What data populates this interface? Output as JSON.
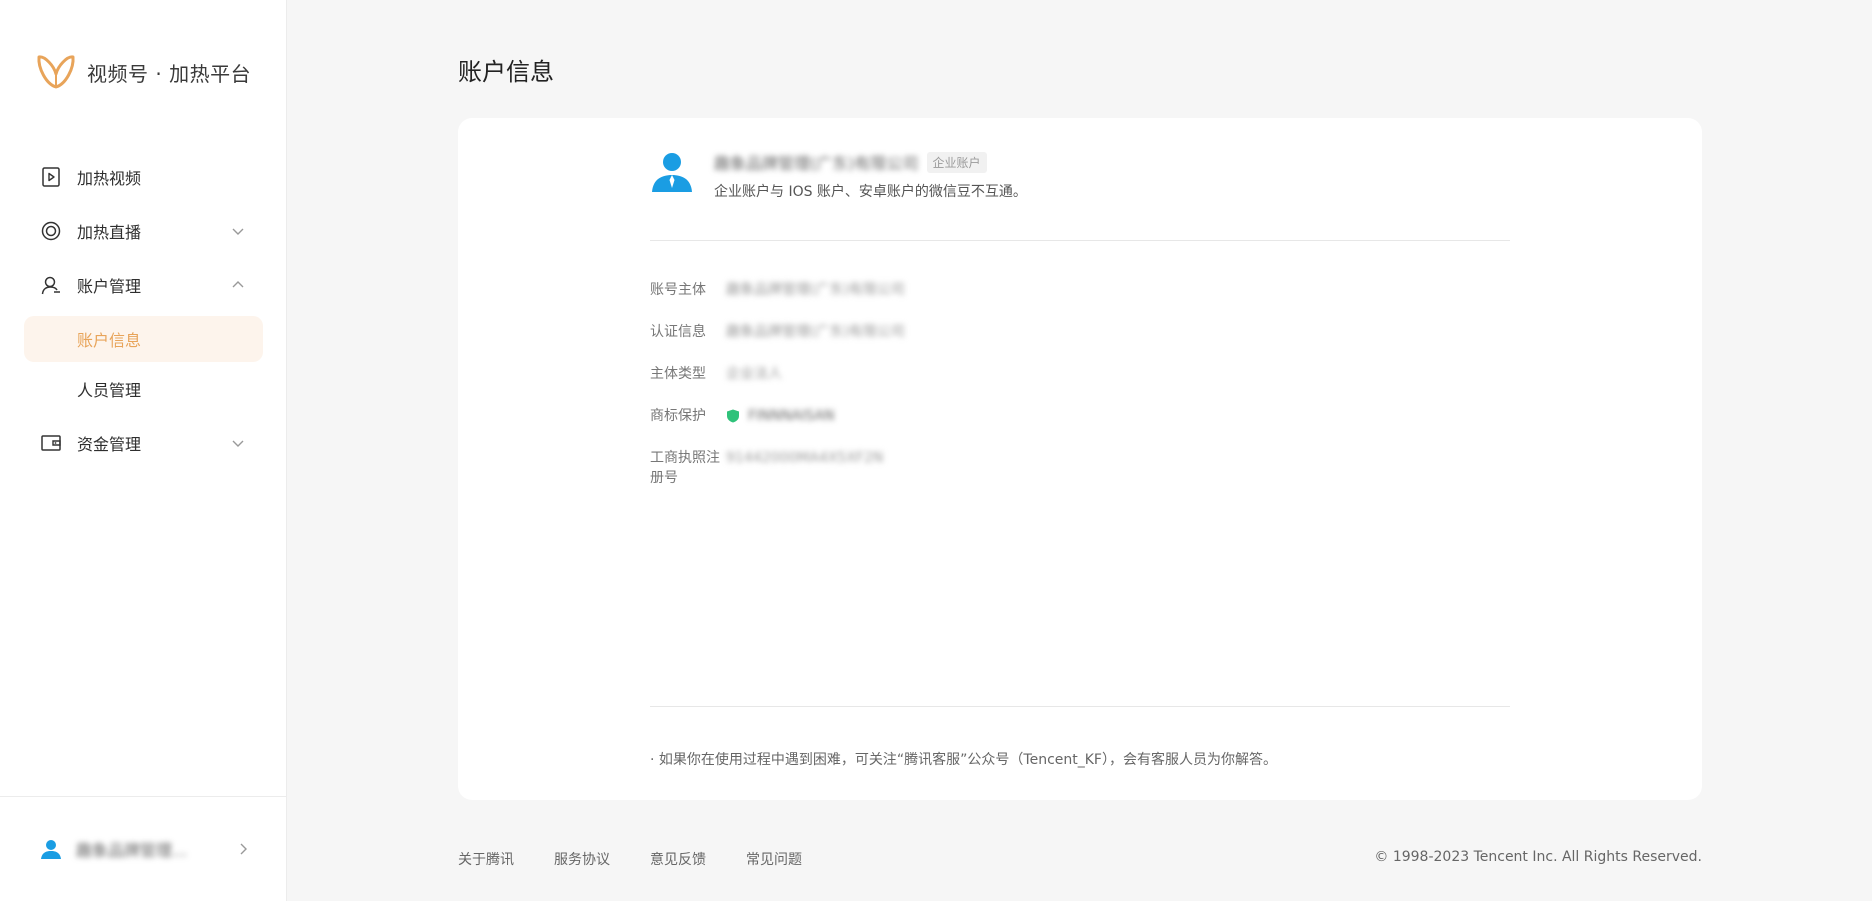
{
  "brand": {
    "title": "视频号 · 加热平台",
    "logo_icon": "butterfly-logo",
    "accent": "#e8a45a"
  },
  "sidebar": {
    "items": [
      {
        "label": "加热视频",
        "icon": "play-video-icon"
      },
      {
        "label": "加热直播",
        "icon": "live-ring-icon",
        "chevron": "down"
      },
      {
        "label": "账户管理",
        "icon": "user-outline-icon",
        "chevron": "up"
      },
      {
        "label": "账户信息",
        "sub": true,
        "active": true
      },
      {
        "label": "人员管理",
        "sub": true
      },
      {
        "label": "资金管理",
        "icon": "wallet-icon",
        "chevron": "down"
      }
    ],
    "user_name": "趣象品牌管理..."
  },
  "page": {
    "title": "账户信息"
  },
  "account": {
    "name": "趣象品牌管理(广东)有限公司",
    "badge": "企业账户",
    "note": "企业账户与 IOS 账户、安卓账户的微信豆不互通。",
    "fields": [
      {
        "label": "账号主体",
        "value": "趣象品牌管理(广东)有限公司"
      },
      {
        "label": "认证信息",
        "value": "趣象品牌管理(广东)有限公司"
      },
      {
        "label": "主体类型",
        "value": "企业法人"
      },
      {
        "label": "商标保护",
        "value": "FINNNAISAN"
      },
      {
        "label": "工商执照注册号",
        "value": "91442000MA4X5XF2N"
      }
    ]
  },
  "help": {
    "text": "· 如果你在使用过程中遇到困难，可关注“腾讯客服”公众号（Tencent_KF），会有客服人员为你解答。"
  },
  "footer": {
    "links": [
      "关于腾讯",
      "服务协议",
      "意见反馈",
      "常见问题"
    ],
    "copyright": "© 1998-2023 Tencent Inc. All Rights Reserved."
  },
  "colors": {
    "accent": "#e8a45a",
    "active_bg": "#fdf4ec",
    "avatar_blue": "#1a9de3",
    "shield_green": "#2fc27a"
  }
}
